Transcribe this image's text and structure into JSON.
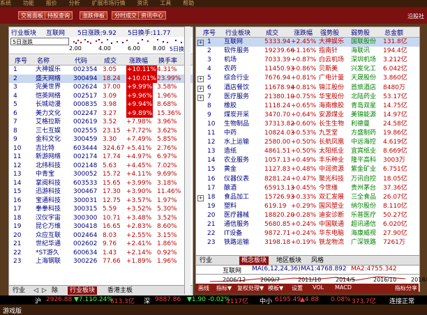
{
  "menu": [
    "系统",
    "功能",
    "报价",
    "分析",
    "扩展市场行情",
    "资讯",
    "工具",
    "帮助"
  ],
  "toolbar": {
    "buttons": [
      "交易面板",
      "持股查询",
      "涨跌停板",
      "分时成交",
      "资讯中心"
    ],
    "right_text": "沿股社"
  },
  "left_panel": {
    "header": [
      "行业板块",
      "互联网",
      "5日涨跌:9.92",
      "5日换手:11.77"
    ],
    "mini_select": "5日涨跌",
    "mini_ticks": [
      "2.00",
      "4.00",
      "6.00",
      "8.00"
    ],
    "mini_button": "5日换手",
    "columns": [
      "序号",
      "名称",
      "代码",
      "成交",
      "涨跌幅",
      "换手率"
    ],
    "rows": [
      [
        "1",
        "大神娱乐",
        "002354",
        "3.05",
        "+10.11%",
        "4.31%"
      ],
      [
        "2",
        "盛天网络",
        "300494",
        "18.24",
        "+10.01%",
        "23.99%"
      ],
      [
        "3",
        "完美世界",
        "002624",
        "37.00",
        "+9.99%",
        "3.58%"
      ],
      [
        "4",
        "恺英网络",
        "002517",
        "3.09",
        "+9.96%",
        "1.96%"
      ],
      [
        "5",
        "长城动漫",
        "000835",
        "3.98",
        "+9.94%",
        "8.68%"
      ],
      [
        "6",
        "美力文化",
        "002247",
        "3.27",
        "+9.89%",
        "15.36%"
      ],
      [
        "7",
        "艾格拉斯",
        "002619",
        "3.52",
        "+7.98%",
        "3.96%"
      ],
      [
        "8",
        "三七互娱",
        "002555",
        "23.15",
        "+7.72%",
        "3.62%"
      ],
      [
        "9",
        "金科文化",
        "300459",
        "3.30",
        "+7.49%",
        "5.85%"
      ],
      [
        "10",
        "吉比特",
        "603444",
        "324.67",
        "+5.41%",
        "2.76%"
      ],
      [
        "11",
        "新游网络",
        "002174",
        "17.74",
        "+4.97%",
        "6.97%"
      ],
      [
        "12",
        "北纬科技",
        "002148",
        "5.63",
        "+4.45%",
        "7.02%"
      ],
      [
        "13",
        "中青宝",
        "300052",
        "15.72",
        "+4.11%",
        "9.69%"
      ],
      [
        "14",
        "掌阅科技",
        "603533",
        "15.65",
        "+3.99%",
        "3.18%"
      ],
      [
        "15",
        "迅游科技",
        "300467",
        "17.30",
        "+3.90%",
        "11.46%"
      ],
      [
        "16",
        "宝通科技",
        "300031",
        "12.75",
        "+3.57%",
        "1.97%"
      ],
      [
        "17",
        "拳拳科技",
        "300315",
        "5.59",
        "+3.52%",
        "5.30%"
      ],
      [
        "18",
        "汉仪宇宙",
        "300300",
        "10.71",
        "+3.48%",
        "3.52%"
      ],
      [
        "19",
        "昆仑万维",
        "300418",
        "16.65",
        "+2.83%",
        "8.60%"
      ],
      [
        "20",
        "众应互联",
        "002464",
        "8.03",
        "+2.55%",
        "3.15%"
      ],
      [
        "21",
        "世纪华通",
        "002602",
        "9.76",
        "+2.41%",
        "1.86%"
      ],
      [
        "22",
        "*ST游久",
        "600634",
        "1.43",
        "+2.14%",
        "0.92%"
      ],
      [
        "23",
        "上海钢联",
        "300226",
        "77.66",
        "+1.89%",
        "1.96%"
      ]
    ],
    "tabs": [
      "行业",
      "◁",
      "▷",
      "除",
      "行业板块",
      "香港主板"
    ]
  },
  "right_panel": {
    "columns": [
      "序号",
      "行业板块",
      "成交",
      "涨跌幅",
      "强势股",
      "弱势股",
      "总金额"
    ],
    "rows": [
      [
        "1",
        "互联网",
        "5333.94",
        "+2.45%",
        "大神娱乐",
        "国联股份",
        "131.8亿"
      ],
      [
        "2",
        "软件服务",
        "19239.66",
        "+1.16%",
        "指南针",
        "海联讯",
        "194.4亿"
      ],
      [
        "3",
        "机场",
        "7033.39",
        "+0.87%",
        "白云机场",
        "深圳机场",
        "3.212亿"
      ],
      [
        "4",
        "农药",
        "11450.93",
        "+0.86%",
        "贝斯美",
        "兴发化工",
        "6.042亿"
      ],
      [
        "5",
        "综合行业",
        "7676.94",
        "+0.81%",
        "广电计量",
        "天晟股份",
        "3.860亿"
      ],
      [
        "6",
        "酒店餐饮",
        "11678.94",
        "+0.81%",
        "锦江股份",
        "首旅酒店",
        "8480万"
      ],
      [
        "7",
        "医疗服务",
        "21380.10",
        "+0.75%",
        "华宝股份",
        "北陆药业",
        "53.17亿"
      ],
      [
        "8",
        "橡胶",
        "1118.24",
        "+0.65%",
        "海南橡胶",
        "青岛双星",
        "14.75亿"
      ],
      [
        "9",
        "煤炭开采",
        "3470.70",
        "+0.64%",
        "安源煤业",
        "美锦能源",
        "14.97亿"
      ],
      [
        "10",
        "生物制品",
        "37313.82",
        "+0.60%",
        "长生生物",
        "利德曼",
        "24.58亿"
      ],
      [
        "11",
        "中药",
        "10824.03",
        "+0.53%",
        "九芝堂",
        "方盛制药",
        "19.86亿"
      ],
      [
        "12",
        "水上运输",
        "2580.00",
        "+0.50%",
        "长航凤凰",
        "中远海控",
        "4.619亿"
      ],
      [
        "13",
        "造纸",
        "4861.51",
        "+0.50%",
        "太阳纸业",
        "宜宾纸业",
        "8.669亿"
      ],
      [
        "14",
        "农业服务",
        "1057.13",
        "+0.49%",
        "丰乐种业",
        "隆平高科",
        "3003万"
      ],
      [
        "15",
        "黄金",
        "1127.83",
        "+0.48%",
        "中润资源",
        "紫金矿业",
        "6.751亿"
      ],
      [
        "16",
        "仪器仪表",
        "8281.24",
        "+0.47%",
        "聚光科技",
        "万讯自控",
        "18.05亿"
      ],
      [
        "17",
        "酿酒",
        "65913.13",
        "+0.45%",
        "今世缘",
        "贵州茅台",
        "37.36亿"
      ],
      [
        "18",
        "食品加工",
        "15726.93",
        "+0.33%",
        "双汇发展",
        "三全食品",
        "26.07亿"
      ],
      [
        "19",
        "塑料",
        "619.19",
        "+0.29%",
        "国风塑业",
        "纳尔股份",
        "8.110亿"
      ],
      [
        "20",
        "医疗器械",
        "18820.20",
        "+0.28%",
        "迪安诊断",
        "乐普医疗",
        "50.27亿"
      ],
      [
        "21",
        "通信服务",
        "5680.85",
        "+0.24%",
        "中国联通",
        "超讯通信",
        "6.020亿"
      ],
      [
        "22",
        "IT设备",
        "9872.71",
        "+0.24%",
        "华东电脑",
        "海康威视",
        "27.90亿"
      ],
      [
        "23",
        "铁路运输",
        "3198.18",
        "+0.19%",
        "铁龙物流",
        "广深铁路",
        "7261万"
      ]
    ],
    "tabs": [
      "行业",
      "概念板块",
      "地区板块",
      "风格"
    ],
    "chart_title": "互联网",
    "chart_indicators": [
      "MA(6,12,24,36)",
      "MA1:4768.892",
      "MA2:4755.342"
    ],
    "chart_dates": [
      "2006/12",
      "2009/7",
      "2011/10",
      "2014/5",
      "2016/10",
      "2018/10"
    ],
    "bottom_tools": [
      "画线",
      "指标▼",
      "复权处理▼",
      "模板▼",
      "设置",
      "VOL",
      "MACD",
      "指标分享"
    ]
  },
  "status": {
    "items": [
      "沪",
      "2926.88",
      "▼7.11",
      "-0.24%",
      "613.3亿",
      "深",
      "9887.86",
      "▼1.90",
      "-0.02%",
      "1117亿",
      "中小",
      "6195.49",
      "▲4.88",
      "0.08%",
      "373.7亿",
      "连接正常"
    ]
  },
  "footer_text": "游戏版"
}
